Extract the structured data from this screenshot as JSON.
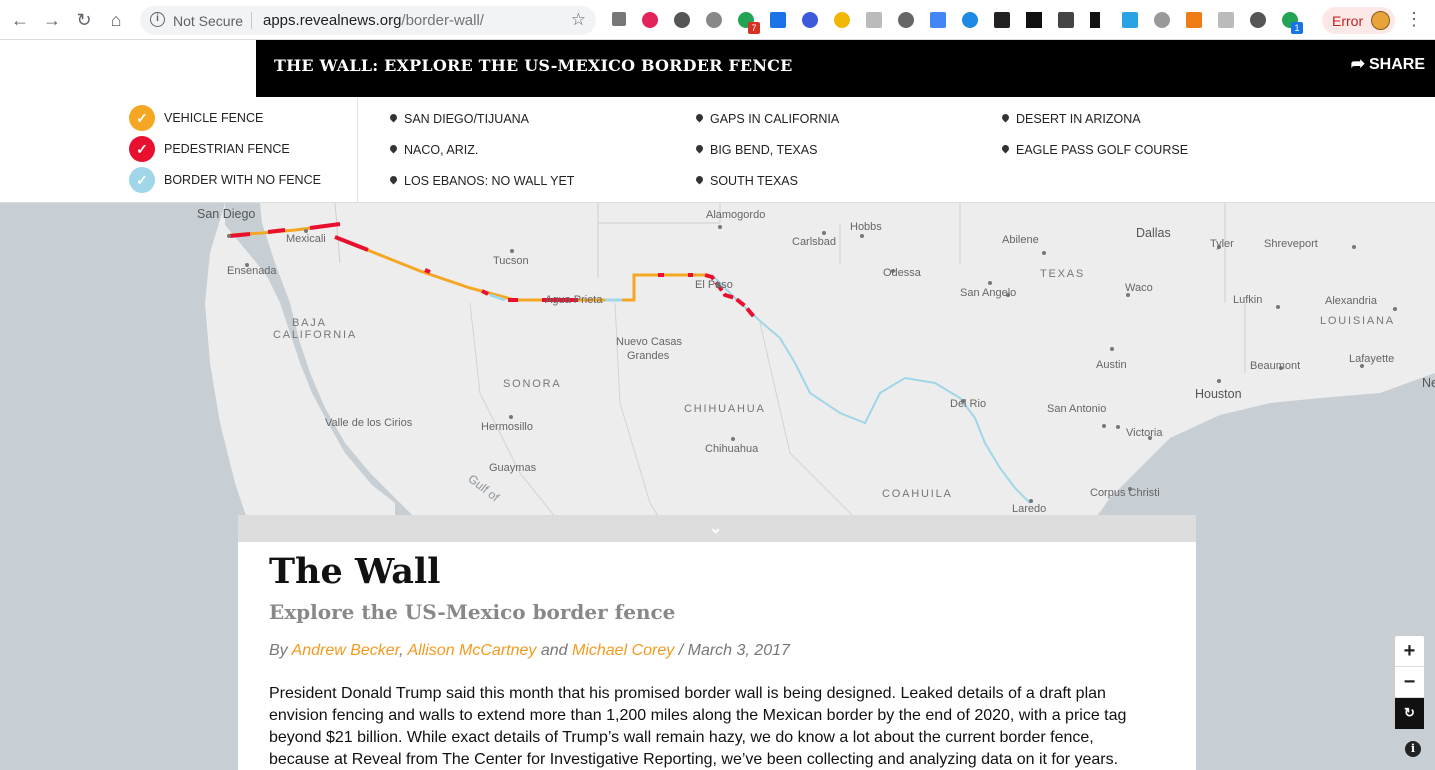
{
  "browser": {
    "security_label": "Not Secure",
    "url_host": "apps.revealnews.org",
    "url_path": "/border-wall/",
    "error_label": "Error",
    "extension_badges": [
      "7",
      "1"
    ]
  },
  "header": {
    "title": "THE WALL: EXPLORE THE US-MEXICO BORDER FENCE",
    "share_label": "SHARE"
  },
  "legend": [
    {
      "label": "VEHICLE FENCE",
      "color": "#f5a623"
    },
    {
      "label": "PEDESTRIAN FENCE",
      "color": "#e8102e"
    },
    {
      "label": "BORDER WITH NO FENCE",
      "color": "#9fd6e8"
    }
  ],
  "locations": [
    [
      "SAN DIEGO/TIJUANA",
      "NACO, ARIZ.",
      "LOS EBANOS: NO WALL YET"
    ],
    [
      "GAPS IN CALIFORNIA",
      "BIG BEND, TEXAS",
      "SOUTH TEXAS"
    ],
    [
      "DESERT IN ARIZONA",
      "EAGLE PASS GOLF COURSE"
    ]
  ],
  "map": {
    "labels": [
      "San Diego",
      "Mexicali",
      "Ensenada",
      "BAJA",
      "CALIFORNIA",
      "Tucson",
      "Agua Prieta",
      "Alamogordo",
      "Carlsbad",
      "Hobbs",
      "El Paso",
      "Odessa",
      "Nuevo Casas",
      "Grandes",
      "SONORA",
      "CHIHUAHUA",
      "Hermosillo",
      "Valle de los Cirios",
      "Chihuahua",
      "Guaymas",
      "Gulf of",
      "Dallas",
      "Tyler",
      "Shreveport",
      "Abilene",
      "TEXAS",
      "San Angelo",
      "Waco",
      "Lufkin",
      "Alexandria",
      "LOUISIANA",
      "Austin",
      "Beaumont",
      "Lafayette",
      "Houston",
      "Del Rio",
      "San Antonio",
      "Victoria",
      "COAHUILA",
      "Corpus Christi",
      "Laredo",
      "Ne"
    ]
  },
  "article": {
    "title": "The Wall",
    "subtitle": "Explore the US-Mexico border fence",
    "by": "By",
    "author1": "Andrew Becker",
    "comma": ",",
    "author2": "Allison McCartney",
    "and": "and",
    "author3": "Michael Corey",
    "date": "/ March 3, 2017",
    "body": "President Donald Trump said this month that his promised border wall is being designed. Leaked details of a draft plan envision fencing and walls to extend more than 1,200 miles along the Mexican border by the end of 2020, with a price tag beyond $21 billion. While exact details of Trump’s wall remain hazy, we do know a lot about the current border fence, because at Reveal from The Center for Investigative Reporting, we’ve been collecting and analyzing data on it for years."
  },
  "controls": {
    "zoom_in": "+",
    "zoom_out": "−",
    "reset": "↻",
    "info": "i",
    "collapse": "⌄"
  }
}
